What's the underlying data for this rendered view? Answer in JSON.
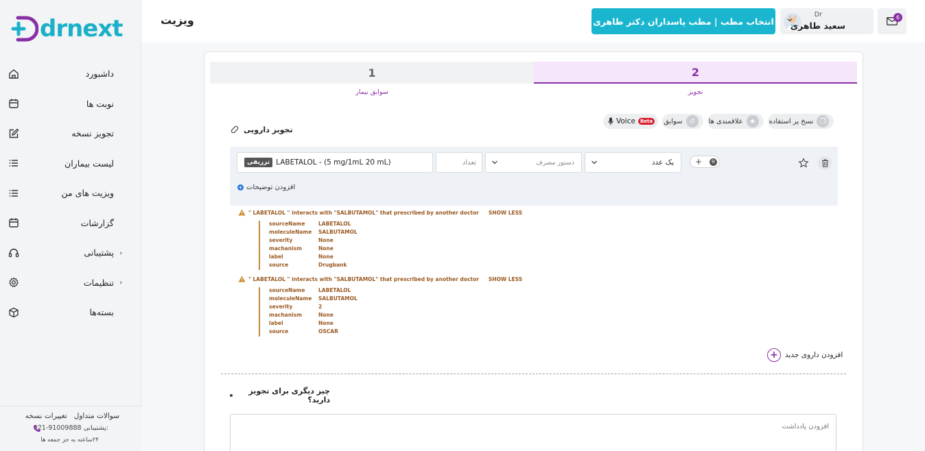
{
  "app": {
    "logo_text": "drnext"
  },
  "header": {
    "title": "ویزیت",
    "clinic_button": "انتخاب مطب | مطب پاسداران دکتر طاهری",
    "user_prefix": "Dr",
    "user_name": "سعید طاهری",
    "mail_count": "6"
  },
  "sidebar": {
    "items": [
      {
        "label": "داشبورد",
        "icon": "home-icon"
      },
      {
        "label": "نوبت ها",
        "icon": "calendar-icon"
      },
      {
        "label": "تجویز نسخه",
        "icon": "edit-icon"
      },
      {
        "label": "لیست بیماران",
        "icon": "list-icon"
      },
      {
        "label": "ویزیت های من",
        "icon": "list-icon"
      },
      {
        "label": "گزارشات",
        "icon": "calendar-icon"
      },
      {
        "label": "پشتیبانی",
        "icon": "headset-icon",
        "expandable": true
      },
      {
        "label": "تنظیمات",
        "icon": "gear-icon",
        "expandable": true
      },
      {
        "label": "بسته‌ها",
        "icon": "box-icon"
      }
    ],
    "footer": {
      "faq": "سوالات متداول",
      "changelog": "تغییرات نسخه",
      "support_label": "پشتیبانی:",
      "support_phone": "021-91009888",
      "hours": "۲۴ساعته به جز جمعه ها"
    }
  },
  "steps": [
    {
      "number": "1",
      "label": "سوابق بیمار",
      "active": false
    },
    {
      "number": "2",
      "label": "تجویز",
      "active": true
    }
  ],
  "toolbar": {
    "copy_used": "نسخ پر استفاده",
    "favorites": "علاقمندی ها",
    "history": "سوابق",
    "voice": "Voice",
    "beta": "Beta"
  },
  "prescription": {
    "section_title": "تجویز دارویی",
    "drug": {
      "name": "LABETALOL - (5 mg/1mL 20 mL)",
      "route_tag": "تزریقی",
      "quantity_placeholder": "تعداد",
      "usage_placeholder": "دستور مصرف",
      "dose_value": "یک عدد",
      "add_description": "افزودن توضیحات"
    },
    "interactions": [
      {
        "message": "\" LABETALOL \" interacts with \"SALBUTAMOL\" that prescribed by another doctor",
        "toggle": "SHOW LESS",
        "details": [
          {
            "key": "sourceName",
            "value": "LABETALOL"
          },
          {
            "key": "moleculeName",
            "value": "SALBUTAMOL"
          },
          {
            "key": "severity",
            "value": "None"
          },
          {
            "key": "machanism",
            "value": "None"
          },
          {
            "key": "label",
            "value": "None"
          },
          {
            "key": "source",
            "value": "Drugbank"
          }
        ]
      },
      {
        "message": "\" LABETALOL \" interacts with \"SALBUTAMOL\" that prescribed by another doctor",
        "toggle": "SHOW LESS",
        "details": [
          {
            "key": "sourceName",
            "value": "LABETALOL"
          },
          {
            "key": "moleculeName",
            "value": "SALBUTAMOL"
          },
          {
            "key": "severity",
            "value": "2"
          },
          {
            "key": "machanism",
            "value": "None"
          },
          {
            "key": "label",
            "value": "None"
          },
          {
            "key": "source",
            "value": "OSCAR"
          }
        ]
      }
    ],
    "add_new_drug": "افزودن داروی جدید",
    "anything_else": "چیز دیگری برای تجویز دارید؟",
    "note_placeholder": "افزودن یادداشت"
  },
  "colors": {
    "accent": "#8a2fa6",
    "primary": "#1ab6cf",
    "warning": "#9a5a22"
  }
}
